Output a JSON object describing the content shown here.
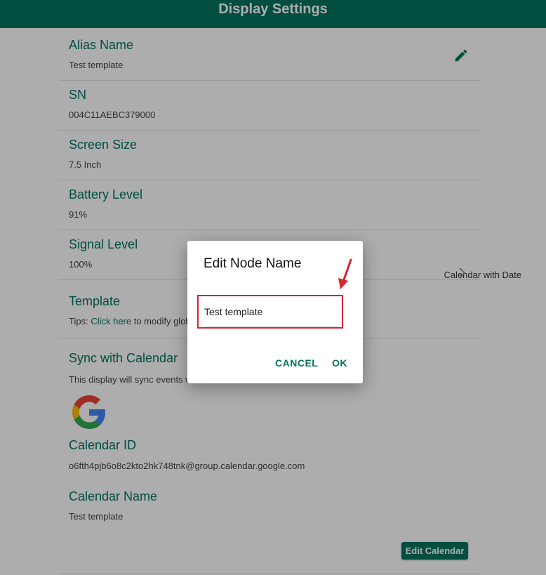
{
  "header": {
    "title": "Display Settings"
  },
  "settings": {
    "alias": {
      "label": "Alias Name",
      "value": "Test template"
    },
    "sn": {
      "label": "SN",
      "value": "004C11AEBC379000"
    },
    "screen_size": {
      "label": "Screen Size",
      "value": "7.5 Inch"
    },
    "battery": {
      "label": "Battery Level",
      "value": "91%"
    },
    "signal": {
      "label": "Signal Level",
      "value": "100%"
    },
    "template": {
      "label": "Template",
      "value": "Calendar with Date",
      "tips_prefix": "Tips: ",
      "tips_link": "Click here",
      "tips_suffix": " to modify glob"
    },
    "sync": {
      "label": "Sync with Calendar",
      "text": "This display will sync events w",
      "calendar_id_label": "Calendar ID",
      "calendar_id": "o6fth4pjb6o8c2kto2hk748tnk@group.calendar.google.com",
      "calendar_name_label": "Calendar Name",
      "calendar_name": "Test template",
      "edit_button": "Edit Calendar"
    }
  },
  "dialog": {
    "title": "Edit Node Name",
    "input_value": "Test template",
    "cancel_label": "CANCEL",
    "ok_label": "OK"
  },
  "colors": {
    "brand": "#00735f",
    "highlight": "#d7262e"
  },
  "icons": {
    "edit": "pencil-icon",
    "chevron": "chevron-right-icon",
    "google": "google-logo-icon",
    "annotation": "red-arrow-icon"
  }
}
